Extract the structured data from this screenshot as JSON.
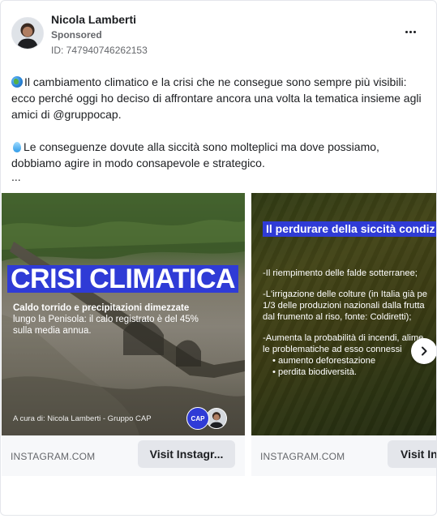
{
  "post": {
    "author": "Nicola Lamberti",
    "sponsored_label": "Sponsored",
    "ad_id": "ID: 747940746262153",
    "more_icon": "more-horizontal-icon"
  },
  "body": {
    "paragraph1": "Il cambiamento climatico e la crisi che ne consegue sono sempre più visibili: ecco perché oggi ho deciso di affrontare ancora una volta la tematica insieme agli amici di @gruppocap.",
    "paragraph2": "Le conseguenze dovute alla siccità sono molteplici ma dove possiamo, dobbiamo agire in modo consapevole e strategico.",
    "ellipsis": "...",
    "emoji1": "globe-emoji",
    "emoji2": "droplet-emoji"
  },
  "carousel": {
    "cards": [
      {
        "headline": "CRISI CLIMATICA",
        "subtitle_bold": "Caldo torrido e precipitazioni dimezzate",
        "subtitle": "lungo la Penisola: il calo registrato è del 45% sulla media annua.",
        "credit": "A cura di: Nicola Lamberti - Gruppo CAP",
        "logo_text": "CAP",
        "domain": "INSTAGRAM.COM",
        "cta": "Visit Instagr..."
      },
      {
        "headline": "Il perdurare della siccità condiz",
        "line1": "-Il riempimento delle falde sotterranee;",
        "line2": "-L'irrigazione delle colture (in Italia già pe",
        "line3": "1/3 delle produzioni nazionali dalla frutta",
        "line4": "dal frumento al riso, fonte: Coldiretti);",
        "line5": "-Aumenta la probabilità di incendi, alime",
        "line6": "le problematiche ad esso connessi",
        "bullet1": "aumento deforestazione",
        "bullet2": "perdita biodiversità.",
        "domain": "INSTAGRAM.COM",
        "cta": "Visit Ins"
      }
    ],
    "next_icon": "chevron-right-icon"
  },
  "colors": {
    "accent_blue": "#2f3bd6",
    "text_primary": "#1c1e21",
    "text_secondary": "#65676b",
    "button_bg": "#e4e6eb"
  }
}
